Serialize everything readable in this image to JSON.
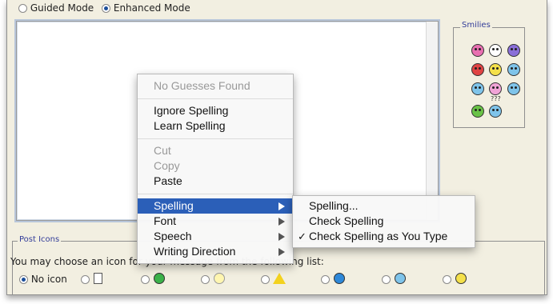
{
  "mode": {
    "guided_label": "Guided Mode",
    "enhanced_label": "Enhanced Mode",
    "selected": "Enhanced Mode"
  },
  "smilies": {
    "legend": "Smilies",
    "items": [
      {
        "icon": "embarrassed-smiley-icon",
        "color": "#e86fb0"
      },
      {
        "icon": "shocked-smiley-icon",
        "color": "#ffffff"
      },
      {
        "icon": "purple-smiley-icon",
        "color": "#8a6fd8"
      },
      {
        "icon": "angry-smiley-icon",
        "color": "#e04444"
      },
      {
        "icon": "smile-smiley-icon",
        "color": "#f4e04a"
      },
      {
        "icon": "wink-smiley-icon",
        "color": "#7fc4ea"
      },
      {
        "icon": "cool-smiley-icon",
        "color": "#7fc4ea"
      },
      {
        "icon": "tongue-smiley-icon",
        "color": "#f0a3d6"
      },
      {
        "icon": "happy-smiley-icon",
        "color": "#7fc4ea"
      },
      {
        "icon": "grin-smiley-icon",
        "color": "#69c246"
      },
      {
        "icon": "confused-smiley-icon",
        "color": "#7fc4ea"
      }
    ],
    "confused_label": "???"
  },
  "post_icons": {
    "legend": "Post Icons",
    "instruction": "You may choose an icon for your message from the following list:",
    "no_icon_label": "No icon",
    "icons": [
      "document-icon",
      "green-arrow-icon",
      "lightbulb-icon",
      "warning-icon",
      "question-icon",
      "cool-icon",
      "smile-icon"
    ]
  },
  "context_menu": {
    "items": [
      {
        "label": "No Guesses Found",
        "enabled": false
      },
      {
        "label": "Ignore Spelling",
        "enabled": true
      },
      {
        "label": "Learn Spelling",
        "enabled": true
      },
      {
        "label": "Cut",
        "enabled": false
      },
      {
        "label": "Copy",
        "enabled": false
      },
      {
        "label": "Paste",
        "enabled": true
      },
      {
        "label": "Spelling",
        "enabled": true,
        "highlighted": true,
        "submenu": true
      },
      {
        "label": "Font",
        "enabled": true,
        "submenu": true
      },
      {
        "label": "Speech",
        "enabled": true,
        "submenu": true
      },
      {
        "label": "Writing Direction",
        "enabled": true,
        "submenu": true
      }
    ]
  },
  "spelling_submenu": {
    "items": [
      {
        "label": "Spelling...",
        "checked": false
      },
      {
        "label": "Check Spelling",
        "checked": false
      },
      {
        "label": "Check Spelling as You Type",
        "checked": true
      }
    ],
    "check_mark": "✓"
  },
  "colors": {
    "highlight": "#2b5fb8",
    "legend_text": "#333d99",
    "panel_bg": "#f2efe1"
  }
}
